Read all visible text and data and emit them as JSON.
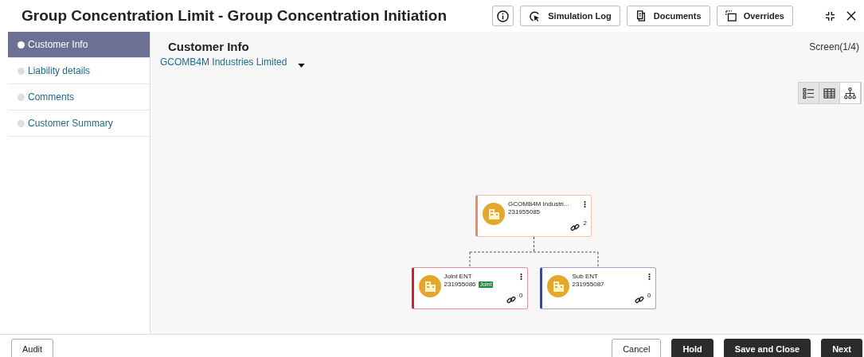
{
  "header": {
    "title": "Group Concentration Limit - Group Concentration Initiation",
    "buttons": [
      {
        "kind": "info"
      },
      {
        "kind": "simulation",
        "label": "Simulation Log"
      },
      {
        "kind": "documents",
        "label": "Documents"
      },
      {
        "kind": "overrides",
        "label": "Overrides"
      }
    ]
  },
  "steps": [
    {
      "label": "Customer Info",
      "selected": true
    },
    {
      "label": "Liability details",
      "selected": false
    },
    {
      "label": "Comments",
      "selected": false
    },
    {
      "label": "Customer Summary",
      "selected": false
    }
  ],
  "main": {
    "title": "Customer Info",
    "screen": "Screen(1/4)",
    "customer": "GCOMB4M Industries Limited"
  },
  "view_modes": [
    {
      "kind": "list",
      "selected": false
    },
    {
      "kind": "table",
      "selected": false
    },
    {
      "kind": "tree",
      "selected": true
    }
  ],
  "tree": {
    "name": "GCOMB4M Industri...",
    "id": "231955085",
    "links": "2",
    "color": "#f5885a",
    "children": [
      {
        "name": "Joint ENT",
        "id": "231955086",
        "badge": "Joint",
        "links": "0",
        "color": "#d0202f"
      },
      {
        "name": "Sub ENT",
        "id": "231955087",
        "links": "0",
        "color": "#3a4b9f"
      }
    ]
  },
  "footer": {
    "audit": "Audit",
    "buttons": [
      {
        "label": "Cancel",
        "kind": "secondary"
      },
      {
        "label": "Hold",
        "kind": "primary"
      },
      {
        "label": "Save and Close",
        "kind": "primary"
      },
      {
        "label": "Next",
        "kind": "primary"
      }
    ]
  }
}
